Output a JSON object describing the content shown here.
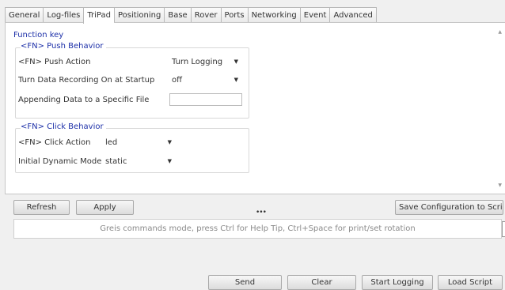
{
  "tabs": [
    {
      "label": "General",
      "active": false
    },
    {
      "label": "Log-files",
      "active": false
    },
    {
      "label": "TriPad",
      "active": true
    },
    {
      "label": "Positioning",
      "active": false
    },
    {
      "label": "Base",
      "active": false
    },
    {
      "label": "Rover",
      "active": false
    },
    {
      "label": "Ports",
      "active": false
    },
    {
      "label": "Networking",
      "active": false
    },
    {
      "label": "Event",
      "active": false
    },
    {
      "label": "Advanced",
      "active": false
    }
  ],
  "panel": {
    "title": "Function key",
    "push": {
      "title": "<FN> Push Behavior",
      "action_label": "<FN> Push Action",
      "action_value": "Turn Logging",
      "startup_label": "Turn Data Recording On at Startup",
      "startup_value": "off",
      "append_label": "Appending Data to a Specific File",
      "append_value": ""
    },
    "click": {
      "title": "<FN> Click Behavior",
      "action_label": "<FN> Click Action",
      "action_value": "led",
      "mode_label": "Initial Dynamic Mode",
      "mode_value": "static"
    }
  },
  "buttons": {
    "refresh": "Refresh",
    "apply": "Apply",
    "save_config": "Save Configuration to Script",
    "send": "Send",
    "clear": "Clear",
    "start_logging": "Start Logging",
    "load_script": "Load Script"
  },
  "command": {
    "hint": "Greis commands mode, press Ctrl for Help Tip, Ctrl+Space for print/set rotation"
  },
  "icons": {
    "caret": "▼",
    "scroll_up": "▲",
    "scroll_down": "▼",
    "grip": "•••"
  },
  "colors": {
    "section_title": "#1c2fa8",
    "panel_bg": "#ffffff",
    "window_bg": "#f0f0f0"
  }
}
